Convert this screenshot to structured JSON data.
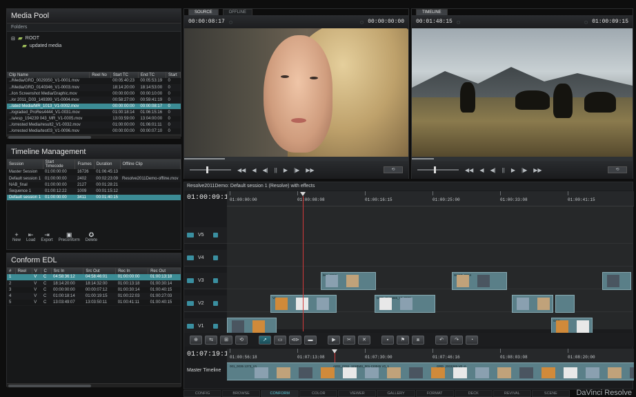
{
  "media_pool": {
    "title": "Media Pool",
    "folders_label": "Folders",
    "tree": [
      {
        "label": "ROOT",
        "indent": 0
      },
      {
        "label": "updated media",
        "indent": 1
      }
    ],
    "columns": [
      "Clip Name",
      "Reel No",
      "Start TC",
      "End TC",
      "Start"
    ],
    "rows": [
      [
        "../Media/GRD_0029350_V1-0001.mov",
        "",
        "00:05:40:23",
        "00:05:53:19",
        "0"
      ],
      [
        "../Media/GRD_0140346_V1-0003.mov",
        "",
        "18:14:20:00",
        "18:14:53:00",
        "0"
      ],
      [
        "../ion Screenshot Media/Graphic.mov",
        "",
        "00:00:00:00",
        "00:00:10:00",
        "0"
      ],
      [
        "../or 2011_D03_149399_V1-0004.mov",
        "",
        "00:58:27:00",
        "00:59:41:19",
        "0"
      ],
      [
        "../ated Media/MR_1013_V1-0002.mov",
        "",
        "00:00:00:00",
        "00:00:08:17",
        "0"
      ],
      [
        "../ograded_ProRes4444_V1-0031.mov",
        "",
        "01:00:18:14",
        "01:06:15:16",
        "0"
      ],
      [
        "../a/esp_194239 043_MR_V1-0005.mov",
        "",
        "13:03:59:00",
        "13:04:00:00",
        "0"
      ],
      [
        "../orrested Media/result2_V1-0032.mov",
        "",
        "01:00:00:00",
        "01:06:01:11",
        "0"
      ],
      [
        "../orrested Media/test03_V1-0096.mov",
        "",
        "00:00:00:00",
        "00:00:07:10",
        "0"
      ]
    ],
    "selected_row": 4
  },
  "timeline_management": {
    "title": "Timeline Management",
    "columns": [
      "Session",
      "Start Timecode",
      "Frames",
      "Duration",
      "Offline Clip"
    ],
    "rows": [
      [
        "Master Session",
        "01:00:00:00",
        "16726",
        "01:06:45:13",
        ""
      ],
      [
        "Default session 1",
        "01:00:00:00",
        "2402",
        "00:02:23:09",
        "Resolve2011Demo-offline.mov"
      ],
      [
        "NAB_final",
        "01:00:00:00",
        "2127",
        "00:01:28:21",
        ""
      ],
      [
        "Sequence 1",
        "01:00:12:22",
        "1009",
        "00:01:15:12",
        ""
      ],
      [
        "Default session 1",
        "01:00:00:00",
        "3411",
        "00:01:40:15",
        ""
      ]
    ],
    "selected_row": 4,
    "actions": [
      {
        "label": "New",
        "icon": "plus-icon",
        "glyph": "+"
      },
      {
        "label": "Load",
        "icon": "load-icon",
        "glyph": "⇤"
      },
      {
        "label": "Export",
        "icon": "export-icon",
        "glyph": "⇥"
      },
      {
        "label": "Preconform",
        "icon": "preconform-icon",
        "glyph": "▣"
      },
      {
        "label": "Delete",
        "icon": "delete-icon",
        "glyph": "✪"
      }
    ]
  },
  "conform_edl": {
    "title": "Conform EDL",
    "columns": [
      "#",
      "Reel",
      "V",
      "C",
      "Src In",
      "Src Out",
      "Rec In",
      "Rec Out"
    ],
    "rows": [
      [
        "1",
        "",
        "V",
        "C",
        "04:58:36:12",
        "04:58:46:01",
        "01:00:00:00",
        "01:00:13:18"
      ],
      [
        "2",
        "",
        "V",
        "C",
        "18:14:20:00",
        "18:14:32:00",
        "01:00:13:18",
        "01:00:30:14"
      ],
      [
        "3",
        "",
        "V",
        "C",
        "00:00:00:00",
        "00:00:07:12",
        "01:00:30:14",
        "01:00:40:15"
      ],
      [
        "4",
        "",
        "V",
        "C",
        "01:00:18:14",
        "01:00:19:15",
        "01:00:22:03",
        "01:00:27:03"
      ],
      [
        "5",
        "",
        "V",
        "C",
        "13:03:49:07",
        "13:03:50:11",
        "01:00:41:11",
        "01:00:40:15"
      ]
    ],
    "selected_row": 0
  },
  "source_viewer": {
    "tabs": [
      "SOURCE",
      "OFFLINE"
    ],
    "active_tab": 0,
    "timecode_left": "00:00:08:17",
    "timecode_right": "00:00:00:00",
    "controls": [
      "◀◀",
      "◀",
      "◀|",
      "||",
      "▶",
      "|▶",
      "▶▶"
    ],
    "progress_fraction": 0.18
  },
  "timeline_viewer": {
    "tabs": [
      "TIMELINE"
    ],
    "active_tab": 0,
    "timecode_left": "00:01:48:15",
    "timecode_right": "01:00:09:15",
    "controls": [
      "◀◀",
      "◀",
      "◀|",
      "||",
      "▶",
      "|▶",
      "▶▶"
    ],
    "progress_fraction": 0.1
  },
  "timeline": {
    "title": "Resolve2011Demo: Default session 1 (Resolve) with effects",
    "current_tc": "01:00:09:15",
    "ruler_ticks": [
      "01:00:00:00",
      "01:00:08:08",
      "01:00:16:15",
      "01:00:25:00",
      "01:00:33:08",
      "01:00:41:15"
    ],
    "tracks": [
      "V5",
      "V4",
      "V3",
      "V2",
      "V1"
    ],
    "clip_labels": [
      "bkp_1013",
      "SHOT_0034",
      "GRD_0140346_V1-0003",
      "V2",
      "GRD"
    ],
    "tools": [
      "⊕",
      "⇆",
      "⊞",
      "⟲",
      "➚",
      "▭",
      "⊲⊳",
      "▬",
      "▶",
      "✂",
      "✕",
      "▪",
      "⚑",
      "⧈",
      "↶",
      "↷",
      "◔"
    ],
    "active_tool": 4,
    "mini_tc": "01:07:19:12",
    "mini_ticks": [
      "01:00:56:18",
      "01:07:13:08",
      "01:07:30:00",
      "01:07:46:16",
      "01:08:03:08",
      "01:08:20:00"
    ],
    "master_label": "Master Timeline",
    "master_clip_labels": [
      "001_0035 1373_V1",
      "A002_C011_121BMS_001-CI0045 V0_1",
      "GRD_2003346-V0 -A"
    ]
  },
  "page_tabs": [
    "CONFIG",
    "BROWSE",
    "CONFORM",
    "COLOR",
    "VIEWER",
    "GALLERY",
    "FORMAT",
    "DECK",
    "REVIVAL",
    "SCENE"
  ],
  "active_page_tab": 2,
  "brand": "DaVinci Resolve",
  "colors": {
    "accent": "#3c8c95",
    "clip": "#5a7f88",
    "playhead": "#d23a3a"
  }
}
